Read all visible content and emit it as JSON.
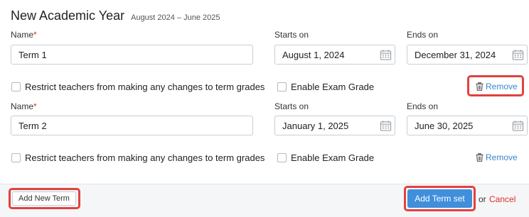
{
  "header": {
    "title": "New Academic Year",
    "subtitle": "August 2024 – June 2025"
  },
  "labels": {
    "name": "Name",
    "required_mark": "*",
    "starts_on": "Starts on",
    "ends_on": "Ends on"
  },
  "terms": [
    {
      "name_value": "Term 1",
      "starts_on_value": "August 1, 2024",
      "ends_on_value": "December 31, 2024",
      "restrict_label": "Restrict teachers from making any changes to term grades",
      "restrict_checked": false,
      "exam_grade_label": "Enable Exam Grade",
      "exam_grade_checked": false,
      "remove_label": "Remove",
      "remove_highlighted": true
    },
    {
      "name_value": "Term 2",
      "starts_on_value": "January 1, 2025",
      "ends_on_value": "June 30, 2025",
      "restrict_label": "Restrict teachers from making any changes to term grades",
      "restrict_checked": false,
      "exam_grade_label": "Enable Exam Grade",
      "exam_grade_checked": false,
      "remove_label": "Remove",
      "remove_highlighted": false
    }
  ],
  "footer": {
    "add_new_term_label": "Add New Term",
    "add_term_set_label": "Add Term set",
    "or_text": "or",
    "cancel_label": "Cancel"
  },
  "icons": {
    "date": "calendar-icon",
    "remove": "trash-icon"
  },
  "colors": {
    "highlight": "#e2413e",
    "primary": "#3f8fdc",
    "link": "#3a87c8",
    "cancel": "#d93025",
    "required": "#d93025"
  }
}
